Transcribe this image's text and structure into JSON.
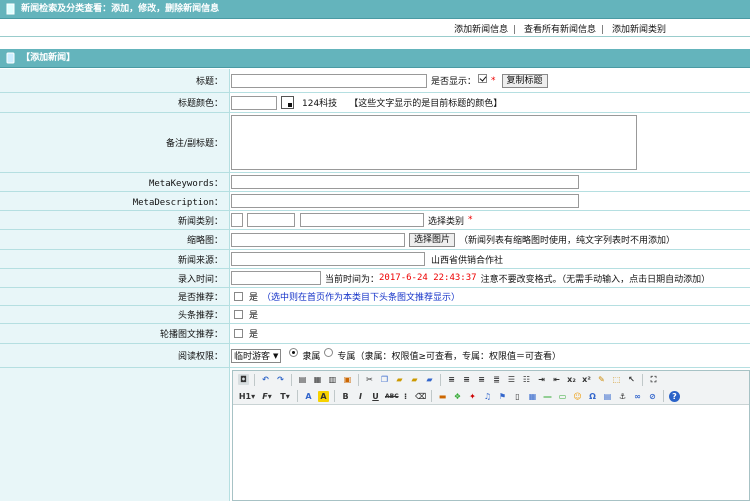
{
  "header": {
    "title": "新闻检索及分类查看：添加，修改，删除新闻信息",
    "links": [
      "添加新闻信息",
      "查看所有新闻信息",
      "添加新闻类别"
    ]
  },
  "section": {
    "title": "【添加新闻】"
  },
  "form": {
    "title": {
      "label": "标题：",
      "show_label": "是否显示：",
      "copy_button": "复制标题"
    },
    "title_color": {
      "label": "标题颜色：",
      "sample": "124科技",
      "hint": "【这些文字显示的是目前标题的颜色】"
    },
    "subtitle": {
      "label": "备注/副标题："
    },
    "meta_keywords": {
      "label": "MetaKeywords："
    },
    "meta_description": {
      "label": "MetaDescription："
    },
    "category": {
      "label": "新闻类别：",
      "select_text": "选择类别"
    },
    "thumbnail": {
      "label": "缩略图：",
      "button": "选择图片",
      "hint": "（新闻列表有缩略图时使用，纯文字列表时不用添加）"
    },
    "source": {
      "label": "新闻来源：",
      "value": "山西省供销合作社"
    },
    "entry_time": {
      "label": "录入时间：",
      "current_prefix": "当前时间为：",
      "current_value": "2017-6-24 22:43:37",
      "hint": "注意不要改变格式。（无需手动输入，点击日期自动添加）"
    },
    "recommend": {
      "label": "是否推荐：",
      "yes": "是",
      "hint": "（选中则在首页作为本类目下头条图文推荐显示）"
    },
    "headline": {
      "label": "头条推荐：",
      "yes": "是"
    },
    "carousel": {
      "label": "轮播图文推荐：",
      "yes": "是"
    },
    "permission": {
      "label": "阅读权限：",
      "select_value": "临时游客",
      "opt1": "隶属",
      "opt2": "专属",
      "hint": "（隶属：权限值≥可查看，专属：权限值＝可查看）"
    }
  },
  "editor": {
    "row1_icons": [
      "source-icon",
      "undo-icon",
      "redo-icon",
      "preview-icon",
      "print-icon",
      "template-icon",
      "code-icon",
      "cut-icon",
      "copy-icon",
      "paste-icon",
      "paste-text-icon",
      "paste-word-icon",
      "align-left-icon",
      "align-center-icon",
      "align-right-icon",
      "justify-icon",
      "ordered-list-icon",
      "unordered-list-icon",
      "indent-icon",
      "outdent-icon",
      "subscript-icon",
      "superscript-icon",
      "clear-format-icon",
      "select-all-icon",
      "fullscreen-icon"
    ],
    "row2": {
      "heading": "H1",
      "font": "F",
      "size": "T",
      "bold": "B",
      "italic": "I",
      "underline": "U",
      "strike": "ABC"
    }
  },
  "colors": {
    "header_bar": "#64b4bc",
    "label_bg": "#e8f6f8",
    "accent_red": "#e00000",
    "hint_blue": "#1533c8"
  }
}
